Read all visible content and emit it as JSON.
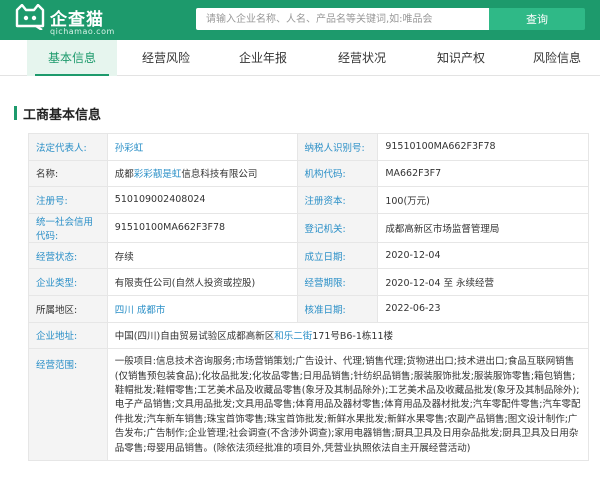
{
  "brand": {
    "name": "企查猫",
    "domain": "qichamao.com"
  },
  "search": {
    "placeholder": "请输入企业名称、人名、产品名等关键词,如:唯品会",
    "button_label": "查询"
  },
  "tabs": [
    {
      "label": "基本信息",
      "active": true
    },
    {
      "label": "经营风险",
      "active": false
    },
    {
      "label": "企业年报",
      "active": false
    },
    {
      "label": "经营状况",
      "active": false
    },
    {
      "label": "知识产权",
      "active": false
    },
    {
      "label": "风险信息",
      "active": false
    }
  ],
  "section": {
    "title": "工商基本信息"
  },
  "info": {
    "legal_rep_label": "法定代表人:",
    "legal_rep_value": "孙彩虹",
    "taxpayer_id_label": "纳税人识别号:",
    "taxpayer_id_value": "91510100MA662F3F78",
    "name_label": "名称:",
    "name_prefix": "成都",
    "name_highlight": "彩彩靓是虹",
    "name_suffix": "信息科技有限公司",
    "org_code_label": "机构代码:",
    "org_code_value": "MA662F3F7",
    "reg_no_label": "注册号:",
    "reg_no_value": "510109002408024",
    "reg_capital_label": "注册资本:",
    "reg_capital_value": "100(万元)",
    "credit_code_label": "统一社会信用代码:",
    "credit_code_value": "91510100MA662F3F78",
    "reg_authority_label": "登记机关:",
    "reg_authority_value": "成都高新区市场监督管理局",
    "status_label": "经营状态:",
    "status_value": "存续",
    "founded_label": "成立日期:",
    "founded_value": "2020-12-04",
    "type_label": "企业类型:",
    "type_value": "有限责任公司(自然人投资或控股)",
    "term_label": "经营期限:",
    "term_value": "2020-12-04 至 永续经营",
    "region_label": "所属地区:",
    "region_value": "四川 成都市",
    "approval_label": "核准日期:",
    "approval_value": "2022-06-23",
    "address_label": "企业地址:",
    "address_prefix": "中国(四川)自由贸易试验区成都高新区",
    "address_highlight": "和乐二街",
    "address_suffix": "171号B6-1栋11楼",
    "scope_label": "经营范围:",
    "scope_value": "一般项目:信息技术咨询服务;市场营销策划;广告设计、代理;销售代理;货物进出口;技术进出口;食品互联网销售(仅销售预包装食品);化妆品批发;化妆品零售;日用品销售;针纺织品销售;服装服饰批发;服装服饰零售;箱包销售;鞋帽批发;鞋帽零售;工艺美术品及收藏品零售(象牙及其制品除外);工艺美术品及收藏品批发(象牙及其制品除外);电子产品销售;文具用品批发;文具用品零售;体育用品及器材零售;体育用品及器材批发;汽车零配件零售;汽车零配件批发;汽车新车销售;珠宝首饰零售;珠宝首饰批发;新鲜水果批发;新鲜水果零售;农副产品销售;图文设计制作;广告发布;广告制作;企业管理;社会调查(不含涉外调查);家用电器销售;厨具卫具及日用杂品批发;厨具卫具及日用杂品零售;母婴用品销售。(除依法须经批准的项目外,凭营业执照依法自主开展经营活动)"
  }
}
